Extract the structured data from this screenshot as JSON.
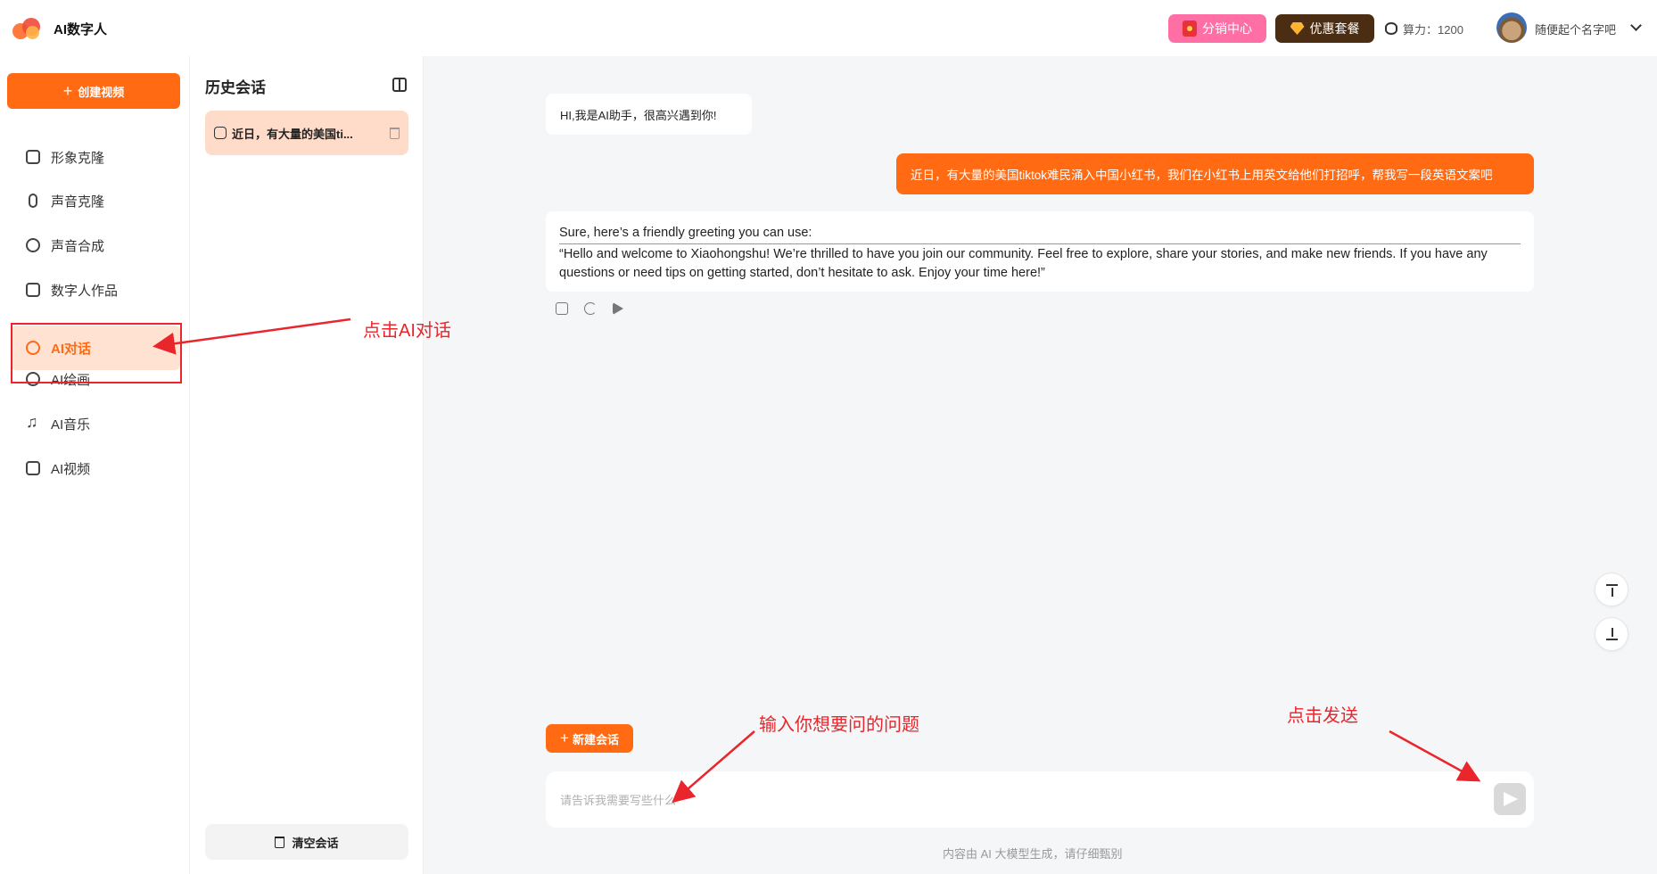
{
  "header": {
    "app_title": "AI数字人",
    "distribution_label": "分销中心",
    "package_label": "优惠套餐",
    "credits_label": "算力：1200",
    "username": "随便起个名字吧",
    "colors": {
      "accent": "#ff6a13",
      "distribution_bg": "#ff6fa5",
      "package_bg": "#4a2d12"
    }
  },
  "sidebar": {
    "create_label": "创建视频",
    "items": [
      {
        "label": "形象克隆",
        "icon": "person-icon"
      },
      {
        "label": "声音克隆",
        "icon": "mic-icon"
      },
      {
        "label": "声音合成",
        "icon": "audio-wave-icon"
      },
      {
        "label": "数字人作品",
        "icon": "video-camera-icon"
      },
      {
        "label": "AI对话",
        "icon": "chat-bubble-icon",
        "active": true
      },
      {
        "label": "AI绘画",
        "icon": "palette-icon"
      },
      {
        "label": "AI音乐",
        "icon": "music-note-icon"
      },
      {
        "label": "AI视频",
        "icon": "video-icon"
      }
    ]
  },
  "history": {
    "title": "历史会话",
    "items": [
      {
        "label": "近日，有大量的美国ti..."
      }
    ],
    "clear_label": "清空会话"
  },
  "chat": {
    "messages": [
      {
        "role": "ai",
        "text": "HI,我是AI助手，很高兴遇到你!"
      },
      {
        "role": "user",
        "text": "近日，有大量的美国tiktok难民涌入中国小红书，我们在小红书上用英文给他们打招呼，帮我写一段英语文案吧"
      },
      {
        "role": "ai",
        "line1": "Sure, here’s a friendly greeting you can use:",
        "line2": " “Hello and welcome to Xiaohongshu! We’re thrilled to have you join our community. Feel free to explore, share your stories, and make new friends. If you have any questions or need tips on getting started, don’t hesitate to ask. Enjoy your time here!”"
      }
    ],
    "new_chat_label": "新建会话",
    "input_placeholder": "请告诉我需要写些什么",
    "footer_note": "内容由 AI 大模型生成，请仔细甄别"
  },
  "annotations": {
    "click_ai_chat": "点击AI对话",
    "input_question": "输入你想要问的问题",
    "click_send": "点击发送",
    "color": "#e8262b"
  }
}
